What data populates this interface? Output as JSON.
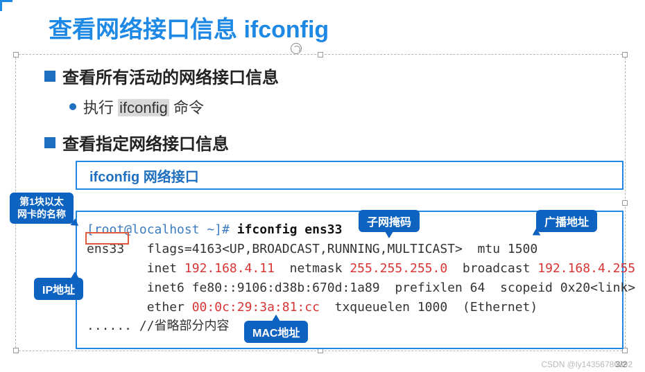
{
  "title": "查看网络接口信息 ifconfig",
  "bullets": {
    "b1a": "查看所有活动的网络接口信息",
    "b2a_pre": "执行 ",
    "b2a_hl": "ifconfig",
    "b2a_post": " 命令",
    "b1b": "查看指定网络接口信息"
  },
  "cmdbox": "ifconfig 网络接口",
  "terminal": {
    "prompt": "[root@localhost ~]# ",
    "cmd": "ifconfig ens33",
    "line2a": "ens33   flags=4163<UP,BROADCAST,RUNNING,MULTICAST>  mtu 1500",
    "line3_pre": "        inet ",
    "line3_ip": "192.168.4.11",
    "line3_mid1": "  netmask ",
    "line3_mask": "255.255.255.0",
    "line3_mid2": "  broadcast ",
    "line3_bc": "192.168.4.255",
    "line4": "        inet6 fe80::9106:d38b:670d:1a89  prefixlen 64  scopeid 0x20<link>",
    "line5_pre": "        ether ",
    "line5_mac": "00:0c:29:3a:81:cc",
    "line5_post": "  txqueuelen 1000  (Ethernet)",
    "line6": "...... //省略部分内容"
  },
  "callouts": {
    "nic_name": "第1块以太\n网卡的名称",
    "subnet": "子网掩码",
    "broadcast": "广播地址",
    "ip": "IP地址",
    "mac": "MAC地址"
  },
  "watermark": "CSDN @ly14356786392",
  "pagenum": "3/2"
}
